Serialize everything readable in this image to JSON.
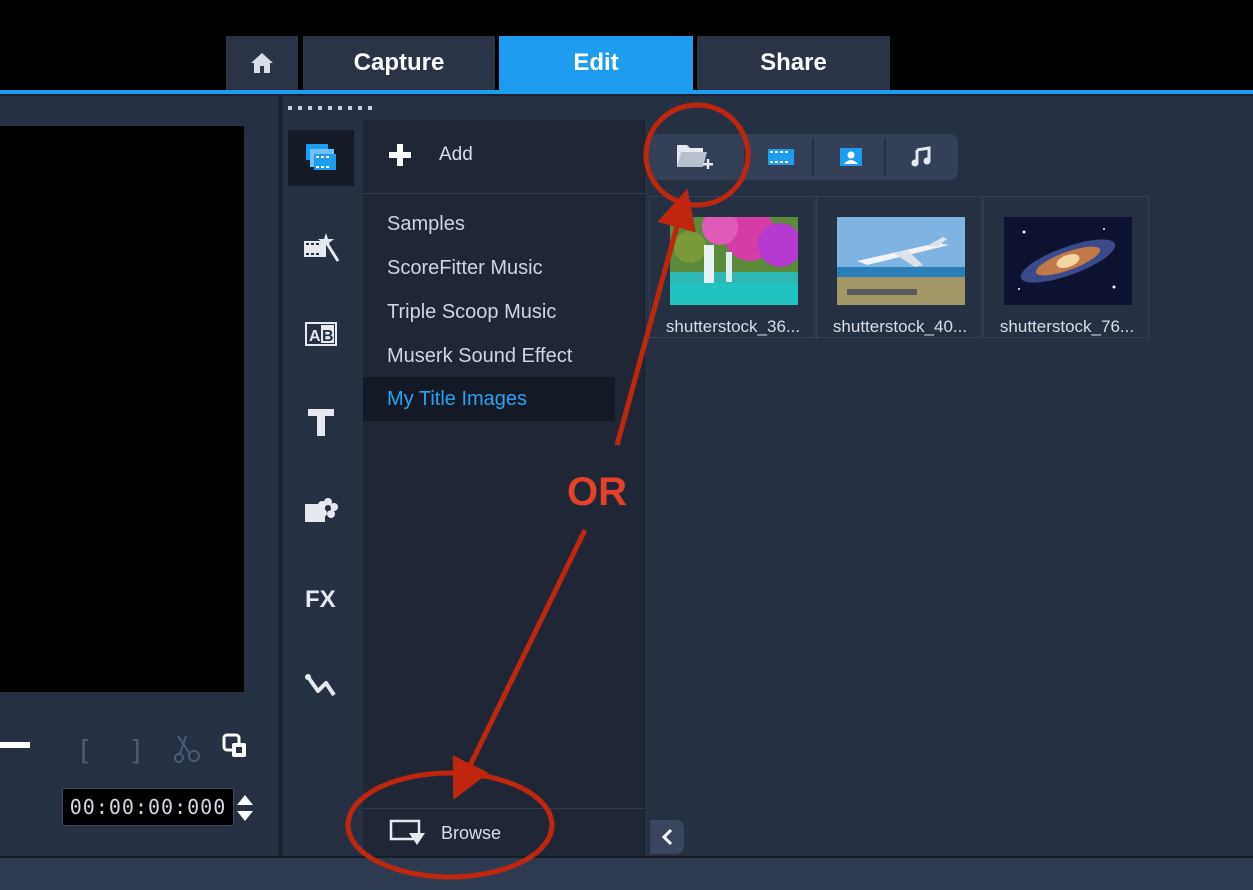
{
  "tabs": {
    "home_icon": "home-icon",
    "capture": "Capture",
    "edit": "Edit",
    "share": "Share"
  },
  "player": {
    "timecode": "00:00:00:000"
  },
  "library": {
    "add_label": "Add",
    "folders": [
      "Samples",
      "ScoreFitter Music",
      "Triple Scoop Music",
      "Muserk Sound Effect",
      "My Title Images"
    ],
    "selected_folder": "My Title Images",
    "browse_label": "Browse",
    "thumbnails": [
      "shutterstock_36...",
      "shutterstock_40...",
      "shutterstock_76..."
    ]
  },
  "annotation": {
    "or_label": "OR"
  },
  "colors": {
    "accent": "#1e9cf0",
    "annotation": "#c0260e"
  }
}
